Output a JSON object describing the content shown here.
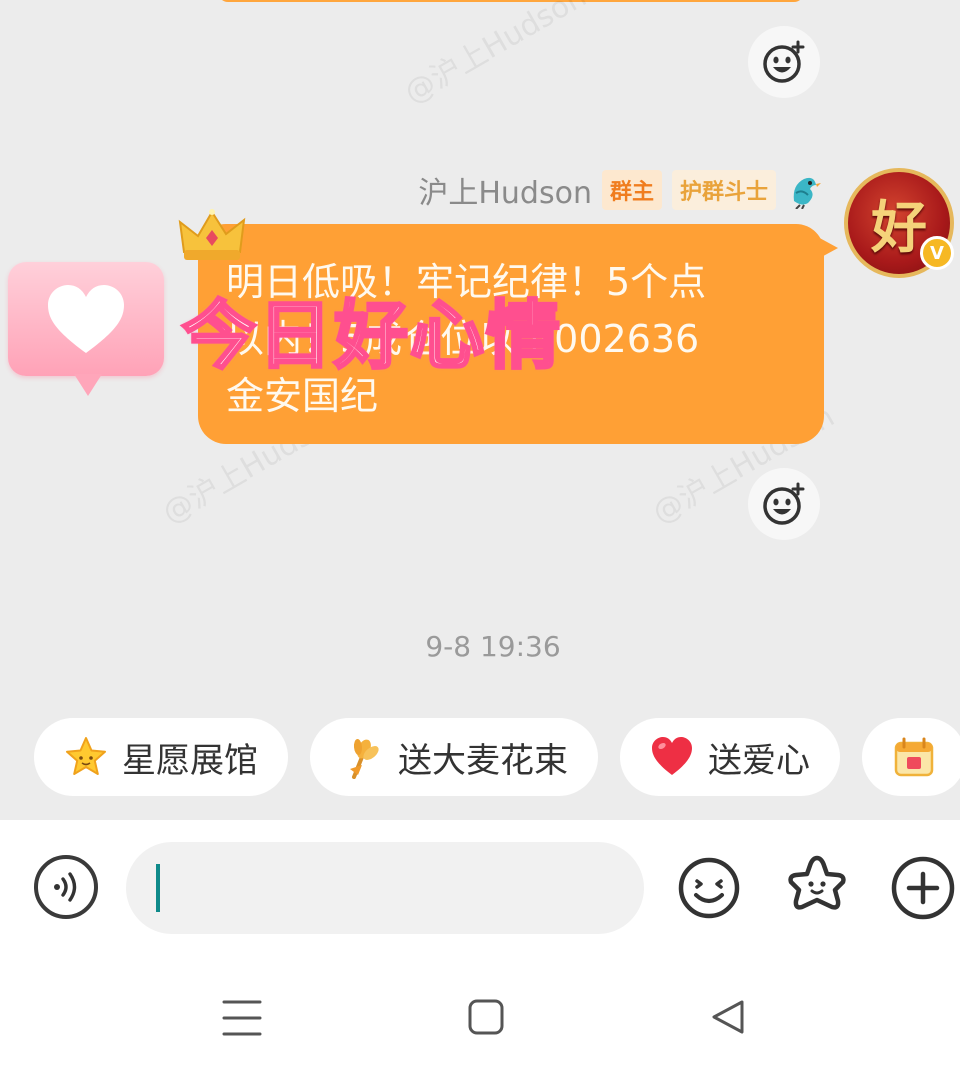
{
  "chat": {
    "watermark": "@沪上Hudson",
    "message": {
      "sender_name": "沪上Hudson",
      "badges": [
        "群主",
        "护群斗士"
      ],
      "avatar_text": "好",
      "avatar_badge": "V",
      "lines": [
        "明日低吸！牢记纪律！5个点",
        "以内！5成仓位以下002636",
        "金安国纪"
      ]
    },
    "sticker": {
      "overlay_text": "今日好心情",
      "icon": "heart-icon"
    },
    "timestamp": "9-8 19:36"
  },
  "quick_actions": [
    {
      "label": "星愿展馆",
      "icon": "star-icon"
    },
    {
      "label": "送大麦花束",
      "icon": "wheat-bouquet-icon"
    },
    {
      "label": "送爱心",
      "icon": "red-heart-icon"
    },
    {
      "label": "",
      "icon": "calendar-gift-icon"
    }
  ],
  "input_bar": {
    "voice_icon": "voice-icon",
    "placeholder": "",
    "emoji_icon": "emoji-icon",
    "sticker_icon": "star-face-icon",
    "plus_icon": "plus-icon"
  },
  "navbar": {
    "menu_icon": "menu-icon",
    "home_icon": "square-home-icon",
    "back_icon": "triangle-back-icon"
  },
  "colors": {
    "bubble": "#ffa035",
    "chat_bg": "#ececec",
    "overlay_stroke": "#ff4f8f"
  }
}
